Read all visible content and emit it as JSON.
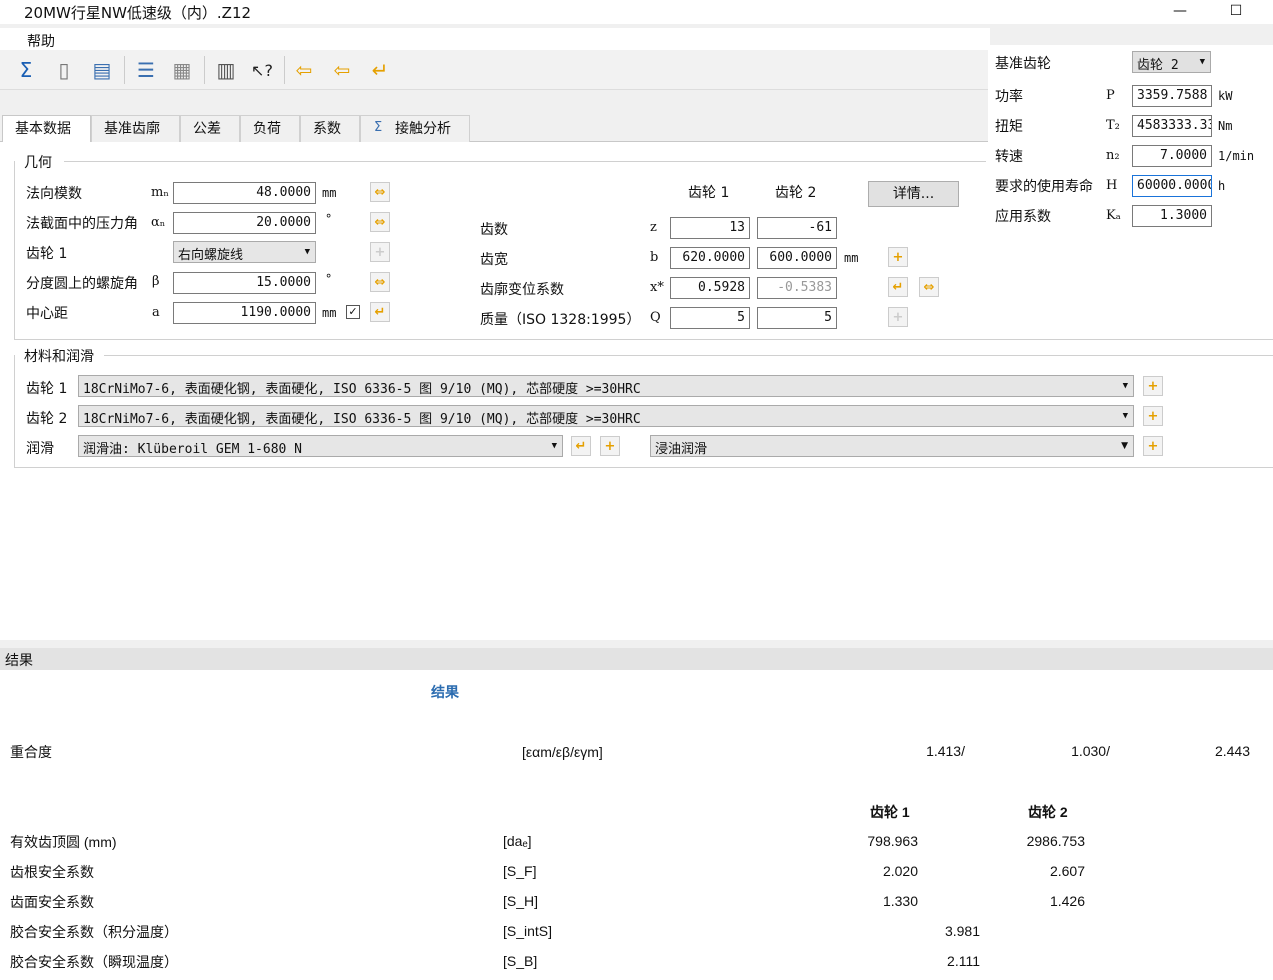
{
  "window": {
    "title": "20MW行星NW低速级（内）.Z12",
    "minimize": "—",
    "maximize": "☐"
  },
  "menu": {
    "help": "帮助"
  },
  "toolbar": {
    "icons": [
      "sum-icon",
      "document-icon",
      "print-icon",
      "list-icon",
      "calculator-icon",
      "book-icon",
      "help-cursor-icon",
      "import-icon",
      "export-icon",
      "return-icon"
    ]
  },
  "tabs": [
    "基本数据",
    "基准齿廓",
    "公差",
    "负荷",
    "系数",
    "接触分析"
  ],
  "geometry": {
    "group": "几何",
    "normal_module": {
      "label": "法向模数",
      "sym": "mₙ",
      "value": "48.0000",
      "unit": "mm"
    },
    "pressure_angle": {
      "label": "法截面中的压力角",
      "sym": "αₙ",
      "value": "20.0000",
      "unit": "°"
    },
    "gear1": {
      "label": "齿轮 1",
      "value": "右向螺旋线"
    },
    "helix_angle": {
      "label": "分度圆上的螺旋角",
      "sym": "β",
      "value": "15.0000",
      "unit": "°"
    },
    "center_distance": {
      "label": "中心距",
      "sym": "a",
      "value": "1190.0000",
      "unit": "mm"
    },
    "col_gear1": "齿轮 1",
    "col_gear2": "齿轮 2",
    "details_button": "详情...",
    "teeth": {
      "label": "齿数",
      "sym": "z",
      "v1": "13",
      "v2": "-61"
    },
    "width": {
      "label": "齿宽",
      "sym": "b",
      "v1": "620.0000",
      "v2": "600.0000",
      "unit": "mm"
    },
    "profile_shift": {
      "label": "齿廓变位系数",
      "sym": "x*",
      "v1": "0.5928",
      "v2": "-0.5383"
    },
    "quality": {
      "label": "质量（ISO 1328:1995）",
      "sym": "Q",
      "v1": "5",
      "v2": "5"
    }
  },
  "right": {
    "ref_gear": {
      "label": "基准齿轮",
      "value": "齿轮 2"
    },
    "power": {
      "label": "功率",
      "sym": "P",
      "value": "3359.7588",
      "unit": "kW"
    },
    "torque": {
      "label": "扭矩",
      "sym": "T₂",
      "value": "4583333.33",
      "unit": "Nm"
    },
    "speed": {
      "label": "转速",
      "sym": "n₂",
      "value": "7.0000",
      "unit": "1/min"
    },
    "life": {
      "label": "要求的使用寿命",
      "sym": "H",
      "value": "60000.0000",
      "unit": "h"
    },
    "app_factor": {
      "label": "应用系数",
      "sym": "Kₐ",
      "value": "1.3000"
    }
  },
  "materials": {
    "group": "材料和润滑",
    "gear1": {
      "label": "齿轮 1",
      "value": "18CrNiMo7-6, 表面硬化钢, 表面硬化, ISO 6336-5 图 9/10 (MQ), 芯部硬度 >=30HRC"
    },
    "gear2": {
      "label": "齿轮 2",
      "value": "18CrNiMo7-6, 表面硬化钢, 表面硬化, ISO 6336-5 图 9/10 (MQ), 芯部硬度 >=30HRC"
    },
    "lube": {
      "label": "润滑",
      "value": "润滑油: Klüberoil GEM 1-680 N",
      "type": "浸油润滑"
    }
  },
  "results": {
    "bar_title": "结果",
    "title": "结果",
    "contact_ratio": {
      "label": "重合度",
      "sym": "[εαm/εβ/εγm]",
      "v1": "1.413/",
      "v2": "1.030/",
      "v3": "2.443"
    },
    "col1": "齿轮 1",
    "col2": "齿轮 2",
    "rows": [
      {
        "label": "有效齿顶圆 (mm)",
        "sym": "[daₑ]",
        "v1": "798.963",
        "v2": "2986.753"
      },
      {
        "label": "齿根安全系数",
        "sym": "[S_F]",
        "v1": "2.020",
        "v2": "2.607"
      },
      {
        "label": "齿面安全系数",
        "sym": "[S_H]",
        "v1": "1.330",
        "v2": "1.426"
      },
      {
        "label": "胶合安全系数（积分温度）",
        "sym": "[S_intS]",
        "v": "3.981"
      },
      {
        "label": "胶合安全系数（瞬现温度）",
        "sym": "[S_B]",
        "v": "2.111"
      }
    ]
  }
}
